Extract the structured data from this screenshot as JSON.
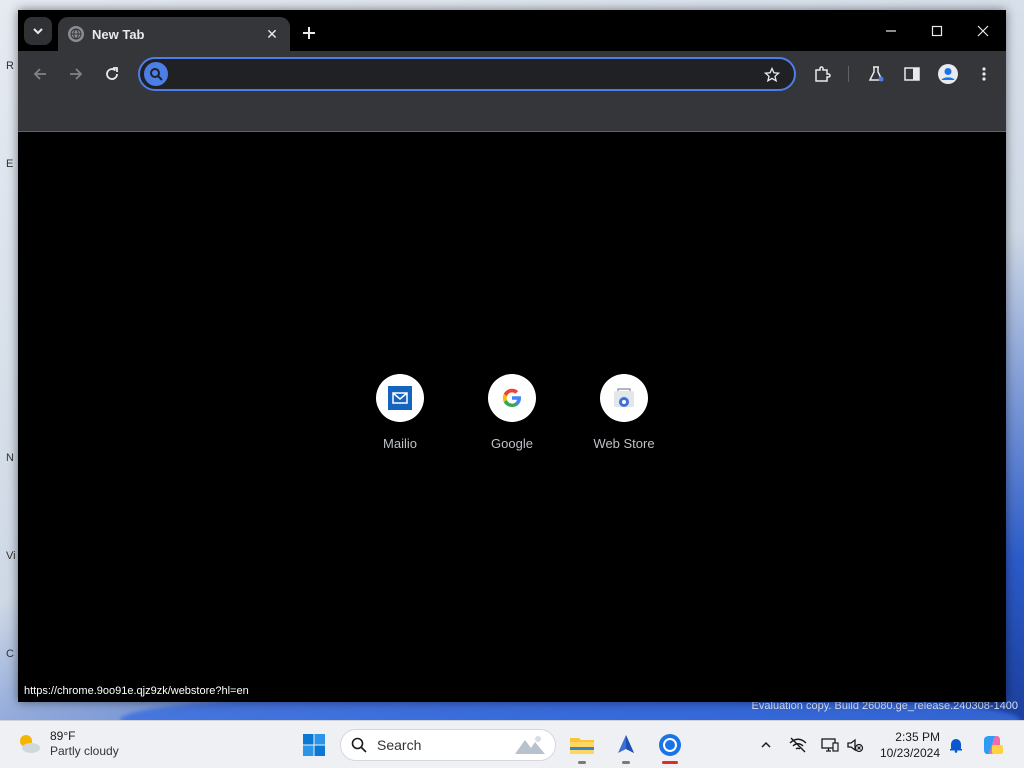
{
  "browser": {
    "tab": {
      "title": "New Tab"
    },
    "omnibox": {
      "value": "",
      "placeholder": ""
    },
    "shortcuts": [
      {
        "label": "Mailio",
        "icon": "mail-icon"
      },
      {
        "label": "Google",
        "icon": "google-icon"
      },
      {
        "label": "Web Store",
        "icon": "web-store-icon"
      }
    ],
    "status_url": "https://chrome.9oo91e.qjz9zk/webstore?hl=en"
  },
  "desktop": {
    "eval_text": "Evaluation copy. Build 26080.ge_release.240308-1400",
    "edge_letters": [
      "R",
      "E",
      "N",
      "Vi",
      "C"
    ]
  },
  "taskbar": {
    "weather": {
      "temp": "89°F",
      "desc": "Partly cloudy"
    },
    "search_label": "Search",
    "clock": {
      "time": "2:35 PM",
      "date": "10/23/2024"
    },
    "apps": [
      "start-icon",
      "file-explorer-icon",
      "app-icon",
      "chrome-icon"
    ]
  },
  "colors": {
    "accent": "#4d7ee8",
    "toolbar": "#35363a",
    "page_bg": "#000000"
  }
}
